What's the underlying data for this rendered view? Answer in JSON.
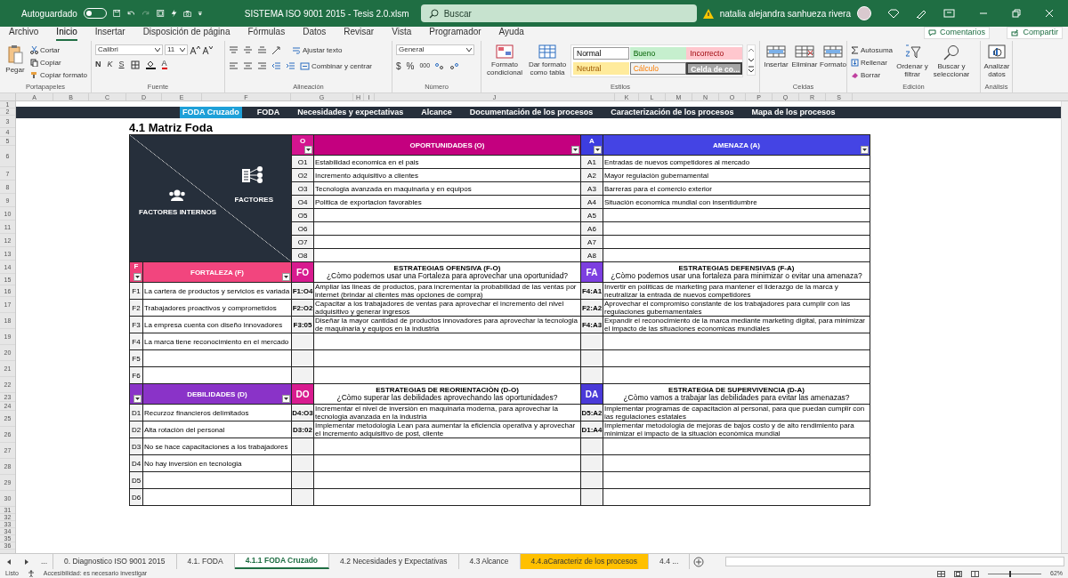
{
  "window": {
    "autosave_label": "Autoguardado",
    "autosave_on": false,
    "title": "SISTEMA ISO 9001 2015 - Tesis 2.0.xlsm",
    "search_placeholder": "Buscar",
    "user": "natalia alejandra sanhueza rivera"
  },
  "menu_tabs": [
    {
      "label": "Archivo",
      "selected": false
    },
    {
      "label": "Inicio",
      "selected": true
    },
    {
      "label": "Insertar",
      "selected": false
    },
    {
      "label": "Disposición de página",
      "selected": false
    },
    {
      "label": "Fórmulas",
      "selected": false
    },
    {
      "label": "Datos",
      "selected": false
    },
    {
      "label": "Revisar",
      "selected": false
    },
    {
      "label": "Vista",
      "selected": false
    },
    {
      "label": "Programador",
      "selected": false
    },
    {
      "label": "Ayuda",
      "selected": false
    }
  ],
  "comments_button": "Comentarios",
  "share_button": "Compartir",
  "ribbon": {
    "clipboard": {
      "label": "Portapapeles",
      "paste": "Pegar",
      "cut": "Cortar",
      "copy": "Copiar",
      "format_painter": "Copiar formato"
    },
    "font": {
      "label": "Fuente",
      "name": "Calibri",
      "size": "11",
      "bold": "N",
      "italic": "K",
      "underline": "S",
      "text_color_button": "A"
    },
    "alignment": {
      "label": "Alineación",
      "wrap": "Ajustar texto",
      "merge": "Combinar y centrar"
    },
    "number": {
      "label": "Número",
      "format": "General",
      "currency": "$",
      "percent": "%",
      "thousands": "000"
    },
    "styles": {
      "label": "Estilos",
      "conditional": "Formato condicional",
      "as_table": "Dar formato como tabla",
      "cell_styles": [
        {
          "label": "Normal",
          "kind": "normal"
        },
        {
          "label": "Bueno",
          "kind": "good"
        },
        {
          "label": "Incorrecto",
          "kind": "bad"
        },
        {
          "label": "Neutral",
          "kind": "neutral"
        },
        {
          "label": "Cálculo",
          "kind": "calculation"
        },
        {
          "label": "Celda de co...",
          "kind": "check"
        }
      ]
    },
    "cells": {
      "label": "Celdas",
      "insert": "Insertar",
      "delete": "Eliminar",
      "format": "Formato"
    },
    "editing": {
      "label": "Edición",
      "autosum": "Autosuma",
      "fill": "Rellenar",
      "clear": "Borrar",
      "sort": "Ordenar y filtrar",
      "find": "Buscar y seleccionar"
    },
    "analysis": {
      "label": "Análisis",
      "analyze": "Analizar datos"
    }
  },
  "column_headers": [
    "A",
    "B",
    "C",
    "D",
    "E",
    "F",
    "G",
    "H",
    "I",
    "J",
    "K",
    "L",
    "M",
    "N",
    "O",
    "P",
    "Q",
    "R",
    "S"
  ],
  "row_headers": [
    "1",
    "2",
    "3",
    "4",
    "5",
    "6",
    "7",
    "8",
    "9",
    "10",
    "11",
    "12",
    "13",
    "14",
    "15",
    "16",
    "17",
    "18",
    "19",
    "20",
    "21",
    "22",
    "23",
    "24",
    "25",
    "26",
    "27",
    "28",
    "29",
    "30",
    "31",
    "32",
    "33",
    "34",
    "35",
    "36"
  ],
  "nav_links": [
    {
      "label": "FODA Cruzado",
      "selected": true
    },
    {
      "label": "FODA",
      "selected": false
    },
    {
      "label": "Necesidades y expectativas",
      "selected": false
    },
    {
      "label": "Alcance",
      "selected": false
    },
    {
      "label": "Documentación de los procesos",
      "selected": false
    },
    {
      "label": "Caracterización de los procesos",
      "selected": false
    },
    {
      "label": "Mapa de los procesos",
      "selected": false
    }
  ],
  "sheet_title": "4.1 Matriz Foda",
  "matrix": {
    "corner": {
      "external_label": "FACTORES",
      "internal_label": "FACTORES INTERNOS"
    },
    "opportunities": {
      "code": "O",
      "title": "OPORTUNIDADES (O)",
      "items": [
        {
          "code": "O1",
          "text": "Estabilidad economica en el pais"
        },
        {
          "code": "O2",
          "text": "Incremento adquisitivo a clientes"
        },
        {
          "code": "O3",
          "text": "Tecnologia avanzada en maquinaria y en equipos"
        },
        {
          "code": "O4",
          "text": "Politica de exportacion favorables"
        },
        {
          "code": "O5"
        },
        {
          "code": "O6"
        },
        {
          "code": "O7"
        },
        {
          "code": "O8"
        }
      ]
    },
    "threats": {
      "code": "A",
      "title": "AMENAZA (A)",
      "items": [
        {
          "code": "A1",
          "text": "Entradas de nuevos competidores al mercado"
        },
        {
          "code": "A2",
          "text": "Mayor regulaciòn gubernamental"
        },
        {
          "code": "A3",
          "text": "Barreras para el comercio exterior"
        },
        {
          "code": "A4",
          "text": "Situaciòn economica mundial con insentidumbre"
        },
        {
          "code": "A5"
        },
        {
          "code": "A6"
        },
        {
          "code": "A7"
        },
        {
          "code": "A8"
        }
      ]
    },
    "strengths": {
      "code": "F",
      "title": "FORTALEZA (F)",
      "items": [
        {
          "code": "F1",
          "text": "La cartera de productos y servicios es variada"
        },
        {
          "code": "F2",
          "text": "Trabajadores proactivos y comprometidos"
        },
        {
          "code": "F3",
          "text": "La empresa cuenta con diseño innovadores"
        },
        {
          "code": "F4",
          "text": "La marca tiene reconocimiento en el mercado"
        },
        {
          "code": "F5"
        },
        {
          "code": "F6"
        }
      ]
    },
    "fo": {
      "code": "FO",
      "title": "ESTRATEGIAS OFENSIVA (F-O)",
      "question": "¿Còmo podemos usar una Fortaleza para aprovechar una oportunidad?",
      "items": [
        {
          "pair": "F1:O4",
          "text": "Ampliar las lineas de productos, para incrementar la probabilidad de las ventas por internet (brindar al clientes màs opciones de compra)"
        },
        {
          "pair": "F2:O2",
          "text": "Capacitar a los trabajadores de ventas para aprovechar el incremento del nivel adquisitivo y generar ingresos"
        },
        {
          "pair": "F3:05",
          "text": "Diseñar la mayor cantidad de productos innovadores para aprovechar la tecnologia de maquinaria y equipos en la industria"
        }
      ]
    },
    "fa": {
      "code": "FA",
      "title": "ESTRATEGIAS DEFENSIVAS (F-A)",
      "question": "¿Còmo podemos usar una fortaleza para minimizar o evitar una amenaza?",
      "items": [
        {
          "pair": "F4:A1",
          "text": "Invertir en politicas de marketing para mantener el liderazgo de la marca y neutralizar la entrada de nuevos competidores"
        },
        {
          "pair": "F2:A2",
          "text": "Aprovechar el compromiso constante de los trabajadores para cumplir con las regulaciones gubernamentales"
        },
        {
          "pair": "F4:A3",
          "text": "Expandir el reconocimiento de la marca mediante marketing digital, para minimizar el impacto de las situaciones economicas mundiales"
        }
      ]
    },
    "weaknesses": {
      "title": "DEBILIDADES (D)",
      "items": [
        {
          "code": "D1",
          "text": "Recurzoz financieros delimitados"
        },
        {
          "code": "D2",
          "text": "Alta rotaciòn del personal"
        },
        {
          "code": "D3",
          "text": "No se hace capacitaciones a los trabajadores"
        },
        {
          "code": "D4",
          "text": "No hay inversiòn en tecnologia"
        },
        {
          "code": "D5"
        },
        {
          "code": "D6"
        }
      ]
    },
    "do": {
      "code": "DO",
      "title": "ESTRATEGIAS DE REORIENTACIÒN (D-O)",
      "question": "¿Còmo superar las debilidades aprovechando las oportunidades?",
      "items": [
        {
          "pair": "D4:O3",
          "text": "Incrementar el nivel de inversiòn en maquinaria moderna, para aprovechar la tecnologia avanzada en la industria"
        },
        {
          "pair": "D3:02",
          "text": "Implementar metodologia Lean para aumentar la eficiencia operativa y aprovechar el incremento adquisitivo de post, cliente"
        }
      ]
    },
    "da": {
      "code": "DA",
      "title": "ESTRATEGIA DE SUPERVIVENCIA (D-A)",
      "question": "¿Còmo vamos a trabajar las debilidades para evitar las amenazas?",
      "items": [
        {
          "pair": "D5:A2",
          "text": "Implementar programas de capacitaciòn al personal, para que puedan cumplir con las regulaciones estatales"
        },
        {
          "pair": "D1:A4",
          "text": "Implementar metodologia de mejoras de bajos costo y de alto rendimiento para minimizar el impacto de la situaciòn econòmica mundial"
        }
      ]
    }
  },
  "sheet_tabs_overflow": "...",
  "sheet_tabs": [
    {
      "label": "0. Diagnostico ISO 9001 2015",
      "selected": false
    },
    {
      "label": "4.1. FODA",
      "selected": false
    },
    {
      "label": "4.1.1 FODA Cruzado",
      "selected": true
    },
    {
      "label": "4.2 Necesidades y Expectativas",
      "selected": false
    },
    {
      "label": "4.3 Alcance",
      "selected": false
    },
    {
      "label": "4.4.aCaracteriz de los procesos",
      "selected": false,
      "color": "#ffc000"
    },
    {
      "label": "4.4 ...",
      "selected": false
    }
  ],
  "status_bar": {
    "state": "Listo",
    "accessibility": "Accesibilidad: es necesario investigar",
    "zoom_label": "62%",
    "zoom": {
      "level": 0.4
    }
  }
}
